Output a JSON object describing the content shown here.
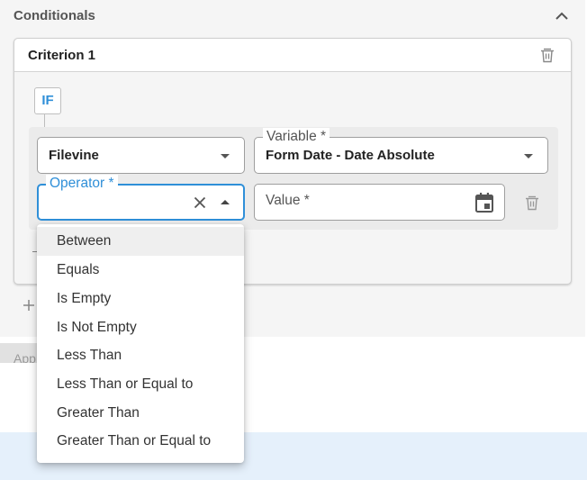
{
  "section": {
    "title": "Conditionals"
  },
  "criterion": {
    "title": "Criterion 1"
  },
  "if_badge": "IF",
  "fields": {
    "source": {
      "value": "Filevine"
    },
    "variable": {
      "label": "Variable *",
      "value": "Form Date - Date Absolute"
    },
    "operator": {
      "label": "Operator *",
      "value": ""
    },
    "value": {
      "placeholder": "Value *"
    }
  },
  "operator_menu": {
    "options": [
      "Between",
      "Equals",
      "Is Empty",
      "Is Not Empty",
      "Less Than",
      "Less Than or Equal to",
      "Greater Than",
      "Greater Than or Equal to"
    ],
    "highlighted": "Between"
  },
  "apply_button": {
    "label": "App"
  },
  "colors": {
    "accent": "#2f8fd8",
    "panel_bg": "#f5f5f5",
    "row_bg": "#ebebeb",
    "bottom_band": "#e5f0fb"
  },
  "icons": {
    "collapse": "chevron-up-icon",
    "delete": "trash-icon",
    "clear": "close-icon",
    "calendar": "calendar-icon",
    "add": "plus-icon"
  }
}
